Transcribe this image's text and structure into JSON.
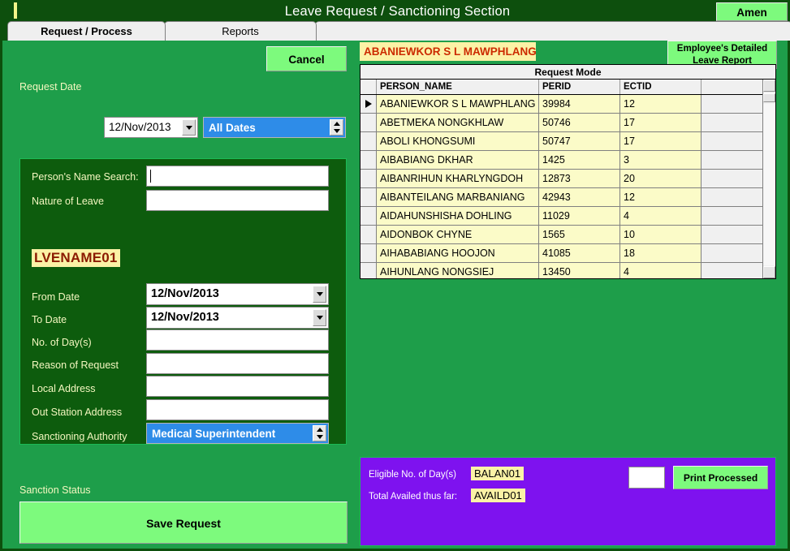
{
  "window": {
    "title": "Leave Request / Sanctioning Section",
    "amen_button": "Amen"
  },
  "tabs": [
    {
      "label": "Request / Process",
      "active": true
    },
    {
      "label": "Reports",
      "active": false
    }
  ],
  "toolbar": {
    "cancel_label": "Cancel"
  },
  "request_date": {
    "label": "Request Date",
    "value": "12/Nov/2013",
    "filter_value": "All Dates"
  },
  "form": {
    "person_search_label": "Person's Name Search:",
    "person_search_value": "",
    "nature_of_leave_label": "Nature of Leave",
    "nature_of_leave_value": "",
    "leave_code_badge": "LVENAME01",
    "from_date_label": "From Date",
    "from_date_value": "12/Nov/2013",
    "to_date_label": "To Date",
    "to_date_value": "12/Nov/2013",
    "no_of_days_label": "No. of Day(s)",
    "no_of_days_value": "",
    "reason_label": "Reason of Request",
    "reason_value": "",
    "local_address_label": "Local Address",
    "local_address_value": "",
    "out_station_address_label": "Out Station Address",
    "out_station_address_value": "",
    "sanctioning_authority_label": "Sanctioning Authority",
    "sanctioning_authority_value": "Medical Superintendent"
  },
  "sanction": {
    "status_label": "Sanction Status",
    "save_label": "Save Request"
  },
  "employee": {
    "name_banner": "ABANIEWKOR S L MAWPHLANG",
    "detail_report_line1": "Employee's Detailed",
    "detail_report_line2": "Leave Report"
  },
  "grid": {
    "caption": "Request Mode",
    "columns": [
      "PERSON_NAME",
      "PERID",
      "ECTID"
    ],
    "selected_row_index": 0,
    "rows": [
      {
        "person_name": "ABANIEWKOR S L MAWPHLANG",
        "perid": "39984",
        "ectid": "12"
      },
      {
        "person_name": "ABETMEKA NONGKHLAW",
        "perid": "50746",
        "ectid": "17"
      },
      {
        "person_name": "ABOLI KHONGSUMI",
        "perid": "50747",
        "ectid": "17"
      },
      {
        "person_name": "AIBABIANG DKHAR",
        "perid": "1425",
        "ectid": "3"
      },
      {
        "person_name": "AIBANRIHUN KHARLYNGDOH",
        "perid": "12873",
        "ectid": "20"
      },
      {
        "person_name": "AIBANTEILANG MARBANIANG",
        "perid": "42943",
        "ectid": "12"
      },
      {
        "person_name": "AIDAHUNSHISHA DOHLING",
        "perid": "11029",
        "ectid": "4"
      },
      {
        "person_name": "AIDONBOK CHYNE",
        "perid": "1565",
        "ectid": "10"
      },
      {
        "person_name": "AIHABABIANG HOOJON",
        "perid": "41085",
        "ectid": "18"
      },
      {
        "person_name": "AIHUNLANG NONGSIEJ",
        "perid": "13450",
        "ectid": "4"
      }
    ]
  },
  "summary": {
    "eligible_label": "Eligible No. of Day(s)",
    "eligible_value": "BALAN01",
    "availed_label": "Total Availed thus far:",
    "availed_value": "AVAILD01",
    "count_input_value": "",
    "print_label": "Print Processed"
  },
  "colors": {
    "title_bar": "#0d4f0d",
    "body": "#1e9e4a",
    "panel": "#0d5c0d",
    "accent_button": "#7dfa7d",
    "grid_row": "#fbfbc8",
    "highlight": "#fbf2a6",
    "summary_panel": "#7e12ef",
    "selected_field": "#2e8ce8"
  }
}
